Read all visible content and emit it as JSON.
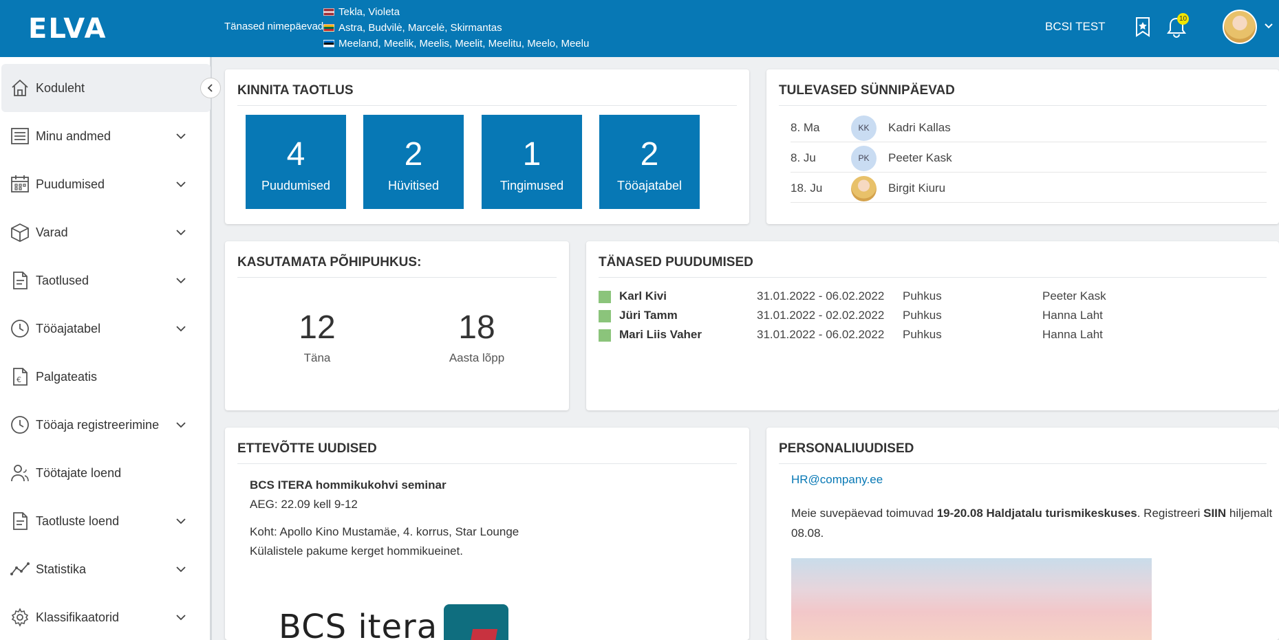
{
  "header": {
    "logo": "ELVA",
    "namedays_label": "Tänased nimepäevad:",
    "namedays": [
      {
        "flag": "latvia",
        "names": "Tekla, Violeta"
      },
      {
        "flag": "lithuania",
        "names": "Astra, Budvilė, Marcelė, Skirmantas"
      },
      {
        "flag": "estonia",
        "names": "Meeland, Meelik, Meelis, Meelit, Meelitu, Meelo, Meelu"
      }
    ],
    "company": "BCSI TEST",
    "notification_count": "10",
    "accent_color": "#0778b5"
  },
  "sidebar": {
    "items": [
      {
        "label": "Koduleht",
        "icon": "home-icon"
      },
      {
        "label": "Minu andmed",
        "icon": "document-list-icon"
      },
      {
        "label": "Puudumised",
        "icon": "calendar-icon"
      },
      {
        "label": "Varad",
        "icon": "box-icon"
      },
      {
        "label": "Taotlused",
        "icon": "file-icon"
      },
      {
        "label": "Tööajatabel",
        "icon": "clock-icon"
      },
      {
        "label": "Palgateatis",
        "icon": "payslip-icon"
      },
      {
        "label": "Tööaja registreerimine",
        "icon": "clock-icon"
      },
      {
        "label": "Töötajate loend",
        "icon": "people-icon"
      },
      {
        "label": "Taotluste loend",
        "icon": "file-icon"
      },
      {
        "label": "Statistika",
        "icon": "chart-line-icon"
      },
      {
        "label": "Klassifikaatorid",
        "icon": "gear-icon"
      }
    ]
  },
  "approve": {
    "title": "KINNITA TAOTLUS",
    "tiles": [
      {
        "count": "4",
        "label": "Puudumised"
      },
      {
        "count": "2",
        "label": "Hüvitised"
      },
      {
        "count": "1",
        "label": "Tingimused"
      },
      {
        "count": "2",
        "label": "Tööajatabel"
      }
    ]
  },
  "birthdays": {
    "title": "TULEVASED SÜNNIPÄEVAD",
    "rows": [
      {
        "date": "8. Ma",
        "initials": "KK",
        "name": "Kadri Kallas"
      },
      {
        "date": "8. Ju",
        "initials": "PK",
        "name": "Peeter Kask"
      },
      {
        "date": "18. Ju",
        "initials": "",
        "name": "Birgit Kiuru"
      }
    ]
  },
  "vacation": {
    "title": "KASUTAMATA PÕHIPUHKUS:",
    "today_value": "12",
    "today_label": "Täna",
    "year_end_value": "18",
    "year_end_label": "Aasta lõpp"
  },
  "absences": {
    "title": "TÄNASED PUUDUMISED",
    "status_color": "#8bc47b",
    "rows": [
      {
        "name": "Karl Kivi",
        "dates": "31.01.2022 - 06.02.2022",
        "type": "Puhkus",
        "approver": "Peeter Kask"
      },
      {
        "name": "Jüri Tamm",
        "dates": "31.01.2022 - 02.02.2022",
        "type": "Puhkus",
        "approver": "Hanna Laht"
      },
      {
        "name": "Mari Liis Vaher",
        "dates": "31.01.2022 - 06.02.2022",
        "type": "Puhkus",
        "approver": "Hanna Laht"
      }
    ]
  },
  "company_news": {
    "title": "ETTEVÕTTE UUDISED",
    "headline": "BCS ITERA hommikukohvi seminar",
    "time": "AEG: 22.09 kell 9-12",
    "place": "Koht: Apollo Kino Mustamäe, 4. korrus, Star Lounge",
    "offer": "Külalistele pakume kerget hommikueinet.",
    "logo_text": "BCS itera"
  },
  "hr_news": {
    "title": "PERSONALIUUDISED",
    "email": "HR@company.ee",
    "text_1": "Meie suvepäevad toimuvad ",
    "text_bold_1": "19-20.08 Haldjatalu turismikeskuses",
    "text_2": ". Registreeri ",
    "text_bold_2": "SIIN",
    "text_3": " hiljemalt 08.08."
  }
}
